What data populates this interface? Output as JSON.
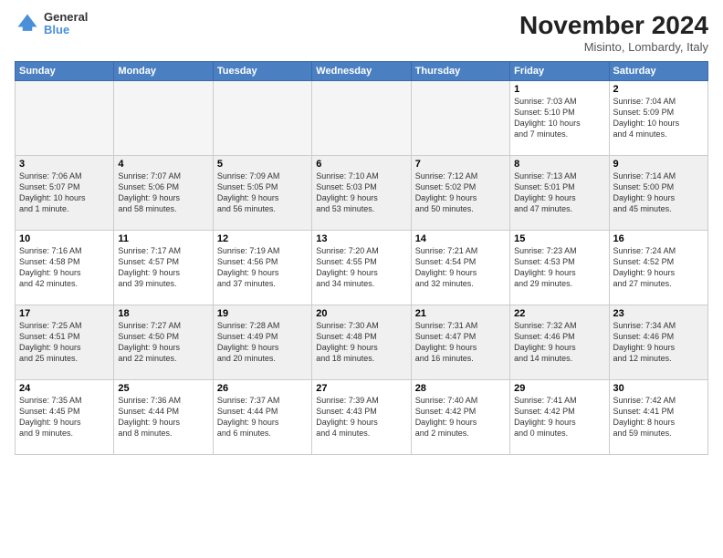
{
  "logo": {
    "general": "General",
    "blue": "Blue"
  },
  "header": {
    "month": "November 2024",
    "location": "Misinto, Lombardy, Italy"
  },
  "weekdays": [
    "Sunday",
    "Monday",
    "Tuesday",
    "Wednesday",
    "Thursday",
    "Friday",
    "Saturday"
  ],
  "rows": [
    [
      {
        "day": "",
        "info": "",
        "empty": true
      },
      {
        "day": "",
        "info": "",
        "empty": true
      },
      {
        "day": "",
        "info": "",
        "empty": true
      },
      {
        "day": "",
        "info": "",
        "empty": true
      },
      {
        "day": "",
        "info": "",
        "empty": true
      },
      {
        "day": "1",
        "info": "Sunrise: 7:03 AM\nSunset: 5:10 PM\nDaylight: 10 hours\nand 7 minutes."
      },
      {
        "day": "2",
        "info": "Sunrise: 7:04 AM\nSunset: 5:09 PM\nDaylight: 10 hours\nand 4 minutes."
      }
    ],
    [
      {
        "day": "3",
        "info": "Sunrise: 7:06 AM\nSunset: 5:07 PM\nDaylight: 10 hours\nand 1 minute."
      },
      {
        "day": "4",
        "info": "Sunrise: 7:07 AM\nSunset: 5:06 PM\nDaylight: 9 hours\nand 58 minutes."
      },
      {
        "day": "5",
        "info": "Sunrise: 7:09 AM\nSunset: 5:05 PM\nDaylight: 9 hours\nand 56 minutes."
      },
      {
        "day": "6",
        "info": "Sunrise: 7:10 AM\nSunset: 5:03 PM\nDaylight: 9 hours\nand 53 minutes."
      },
      {
        "day": "7",
        "info": "Sunrise: 7:12 AM\nSunset: 5:02 PM\nDaylight: 9 hours\nand 50 minutes."
      },
      {
        "day": "8",
        "info": "Sunrise: 7:13 AM\nSunset: 5:01 PM\nDaylight: 9 hours\nand 47 minutes."
      },
      {
        "day": "9",
        "info": "Sunrise: 7:14 AM\nSunset: 5:00 PM\nDaylight: 9 hours\nand 45 minutes."
      }
    ],
    [
      {
        "day": "10",
        "info": "Sunrise: 7:16 AM\nSunset: 4:58 PM\nDaylight: 9 hours\nand 42 minutes."
      },
      {
        "day": "11",
        "info": "Sunrise: 7:17 AM\nSunset: 4:57 PM\nDaylight: 9 hours\nand 39 minutes."
      },
      {
        "day": "12",
        "info": "Sunrise: 7:19 AM\nSunset: 4:56 PM\nDaylight: 9 hours\nand 37 minutes."
      },
      {
        "day": "13",
        "info": "Sunrise: 7:20 AM\nSunset: 4:55 PM\nDaylight: 9 hours\nand 34 minutes."
      },
      {
        "day": "14",
        "info": "Sunrise: 7:21 AM\nSunset: 4:54 PM\nDaylight: 9 hours\nand 32 minutes."
      },
      {
        "day": "15",
        "info": "Sunrise: 7:23 AM\nSunset: 4:53 PM\nDaylight: 9 hours\nand 29 minutes."
      },
      {
        "day": "16",
        "info": "Sunrise: 7:24 AM\nSunset: 4:52 PM\nDaylight: 9 hours\nand 27 minutes."
      }
    ],
    [
      {
        "day": "17",
        "info": "Sunrise: 7:25 AM\nSunset: 4:51 PM\nDaylight: 9 hours\nand 25 minutes."
      },
      {
        "day": "18",
        "info": "Sunrise: 7:27 AM\nSunset: 4:50 PM\nDaylight: 9 hours\nand 22 minutes."
      },
      {
        "day": "19",
        "info": "Sunrise: 7:28 AM\nSunset: 4:49 PM\nDaylight: 9 hours\nand 20 minutes."
      },
      {
        "day": "20",
        "info": "Sunrise: 7:30 AM\nSunset: 4:48 PM\nDaylight: 9 hours\nand 18 minutes."
      },
      {
        "day": "21",
        "info": "Sunrise: 7:31 AM\nSunset: 4:47 PM\nDaylight: 9 hours\nand 16 minutes."
      },
      {
        "day": "22",
        "info": "Sunrise: 7:32 AM\nSunset: 4:46 PM\nDaylight: 9 hours\nand 14 minutes."
      },
      {
        "day": "23",
        "info": "Sunrise: 7:34 AM\nSunset: 4:46 PM\nDaylight: 9 hours\nand 12 minutes."
      }
    ],
    [
      {
        "day": "24",
        "info": "Sunrise: 7:35 AM\nSunset: 4:45 PM\nDaylight: 9 hours\nand 9 minutes."
      },
      {
        "day": "25",
        "info": "Sunrise: 7:36 AM\nSunset: 4:44 PM\nDaylight: 9 hours\nand 8 minutes."
      },
      {
        "day": "26",
        "info": "Sunrise: 7:37 AM\nSunset: 4:44 PM\nDaylight: 9 hours\nand 6 minutes."
      },
      {
        "day": "27",
        "info": "Sunrise: 7:39 AM\nSunset: 4:43 PM\nDaylight: 9 hours\nand 4 minutes."
      },
      {
        "day": "28",
        "info": "Sunrise: 7:40 AM\nSunset: 4:42 PM\nDaylight: 9 hours\nand 2 minutes."
      },
      {
        "day": "29",
        "info": "Sunrise: 7:41 AM\nSunset: 4:42 PM\nDaylight: 9 hours\nand 0 minutes."
      },
      {
        "day": "30",
        "info": "Sunrise: 7:42 AM\nSunset: 4:41 PM\nDaylight: 8 hours\nand 59 minutes."
      }
    ]
  ]
}
